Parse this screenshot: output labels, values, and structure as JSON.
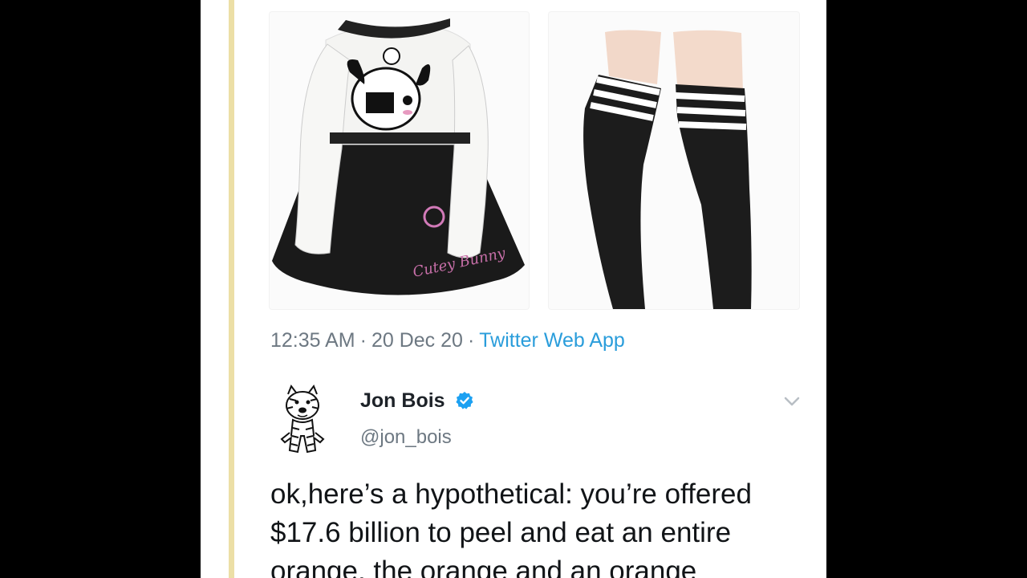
{
  "media": [
    {
      "alt": "black and white bunny sweater dress"
    },
    {
      "alt": "black striped thigh-high socks"
    }
  ],
  "tweet_meta": {
    "time": "12:35 AM",
    "sep1": "·",
    "date": "20 Dec 20",
    "sep2": "·",
    "source": "Twitter Web App"
  },
  "quoted_tweet": {
    "display_name": "Jon Bois",
    "handle": "@jon_bois",
    "text": "ok,here’s a hypothetical: you’re offered $17.6 billion to peel and eat an entire orange, the orange and an orange"
  },
  "icons": {
    "verified": "verified-badge-icon",
    "caret": "chevron-down-icon",
    "avatar": "tiger-cartoon-avatar"
  },
  "colors": {
    "background": "#000000",
    "panel": "#ffffff",
    "thread_line": "#ecdfa6",
    "link": "#2a9ddb",
    "muted": "#6d7882",
    "verified": "#1da1f2"
  }
}
